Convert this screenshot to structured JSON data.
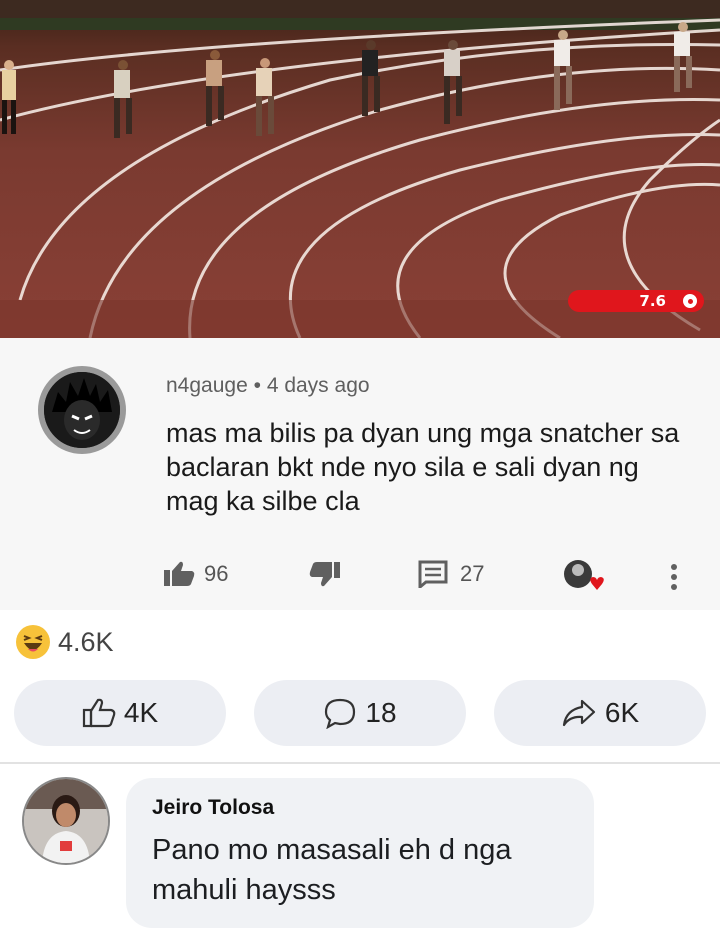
{
  "video": {
    "time_badge": "7.6"
  },
  "yt_comment": {
    "username": "n4gauge",
    "separator": "•",
    "age": "4 days ago",
    "text": "mas ma bilis pa dyan ung mga snatcher sa baclaran bkt nde nyo sila e sali dyan ng mag ka silbe cla",
    "likes": "96",
    "replies": "27"
  },
  "reactions": {
    "count": "4.6K"
  },
  "actions": {
    "like_count": "4K",
    "comment_count": "18",
    "share_count": "6K"
  },
  "comment": {
    "author": "Jeiro Tolosa",
    "text": "Pano mo masasali eh d nga mahuli haysss"
  },
  "colors": {
    "track": "#8a4036",
    "badge_red": "#e0161c",
    "haha_yellow": "#f7c23a",
    "button_bg": "#eceef3",
    "bubble_bg": "#f0f2f5"
  },
  "icons": {
    "like": "thumbs-up-icon",
    "dislike": "thumbs-down-icon",
    "reply": "comment-icon",
    "heart": "creator-heart-icon",
    "more": "more-vertical-icon",
    "haha": "haha-reaction-icon",
    "share": "share-arrow-icon"
  }
}
